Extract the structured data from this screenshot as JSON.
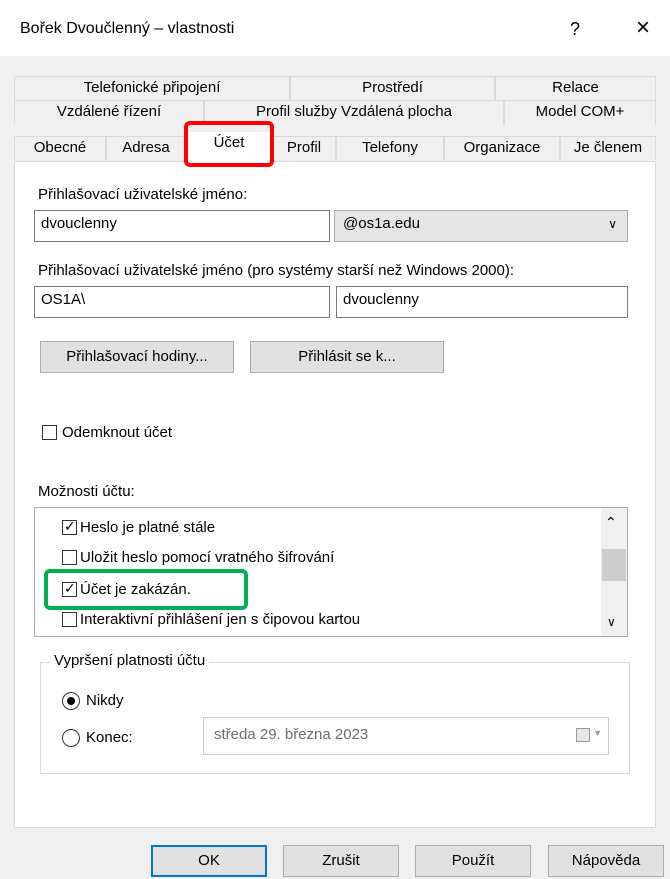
{
  "window": {
    "title": "Bořek Dvoučlenný – vlastnosti",
    "help_label": "?",
    "close_label": "×"
  },
  "tabs": {
    "row1": [
      "Telefonické připojení",
      "Prostředí",
      "Relace"
    ],
    "row2": [
      "Vzdálené řízení",
      "Profil služby Vzdálená plocha",
      "Model COM+"
    ],
    "row3": [
      "Obecné",
      "Adresa",
      "Účet",
      "Profil",
      "Telefony",
      "Organizace",
      "Je členem"
    ],
    "active": "Účet"
  },
  "account": {
    "logon_name_label": "Přihlašovací uživatelské jméno:",
    "logon_name_value": "dvouclenny",
    "domain_value": "@os1a.edu",
    "legacy_label": "Přihlašovací uživatelské jméno (pro systémy starší než Windows 2000):",
    "legacy_domain_value": "OS1A\\",
    "legacy_name_value": "dvouclenny",
    "logon_hours_button": "Přihlašovací hodiny...",
    "logon_to_button": "Přihlásit se k...",
    "unlock_label": "Odemknout účet",
    "options_label": "Možnosti účtu:",
    "options": [
      {
        "label": "Heslo je platné stále",
        "checked": true
      },
      {
        "label": "Uložit heslo pomocí vratného šifrování",
        "checked": false
      },
      {
        "label": "Účet je zakázán.",
        "checked": true
      },
      {
        "label": "Interaktivní přihlášení jen s čipovou kartou",
        "checked": false
      }
    ],
    "expiry_group": "Vypršení platnosti účtu",
    "never_label": "Nikdy",
    "end_label": "Konec:",
    "end_date": "středa 29.  března  2023",
    "never_selected": true
  },
  "buttons": {
    "ok": "OK",
    "cancel": "Zrušit",
    "apply": "Použít",
    "help": "Nápověda"
  },
  "highlights": {
    "red": "#ff0000",
    "green": "#00b050"
  }
}
